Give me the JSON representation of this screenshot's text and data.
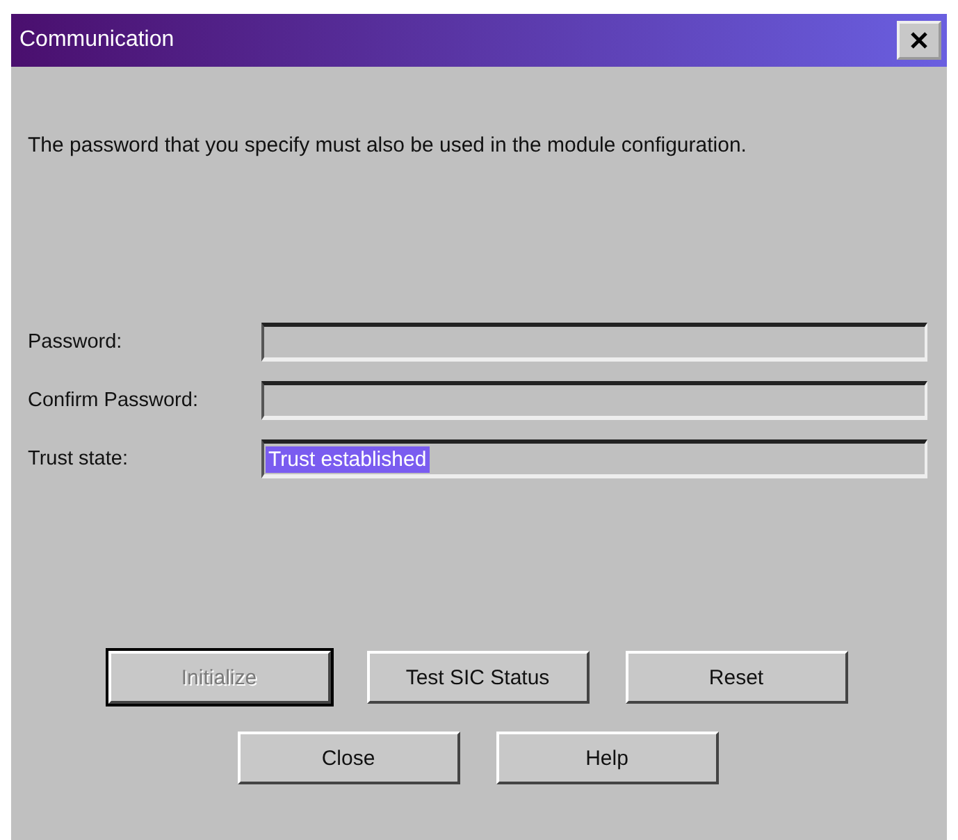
{
  "window": {
    "title": "Communication"
  },
  "message": "The password that you specify must also be used in the module configuration.",
  "fields": [
    {
      "label": "Password:"
    },
    {
      "label": "Confirm Password:"
    },
    {
      "label": "Trust state:",
      "value": "Trust established",
      "selected": true
    }
  ],
  "button_rows": [
    [
      {
        "label": "Initialize",
        "disabled": true,
        "default": true
      },
      {
        "label": "Test SIC Status",
        "disabled": false,
        "default": false
      },
      {
        "label": "Reset",
        "disabled": false,
        "default": false
      }
    ],
    [
      {
        "label": "Close",
        "disabled": false,
        "default": false
      },
      {
        "label": "Help",
        "disabled": false,
        "default": false
      }
    ]
  ]
}
